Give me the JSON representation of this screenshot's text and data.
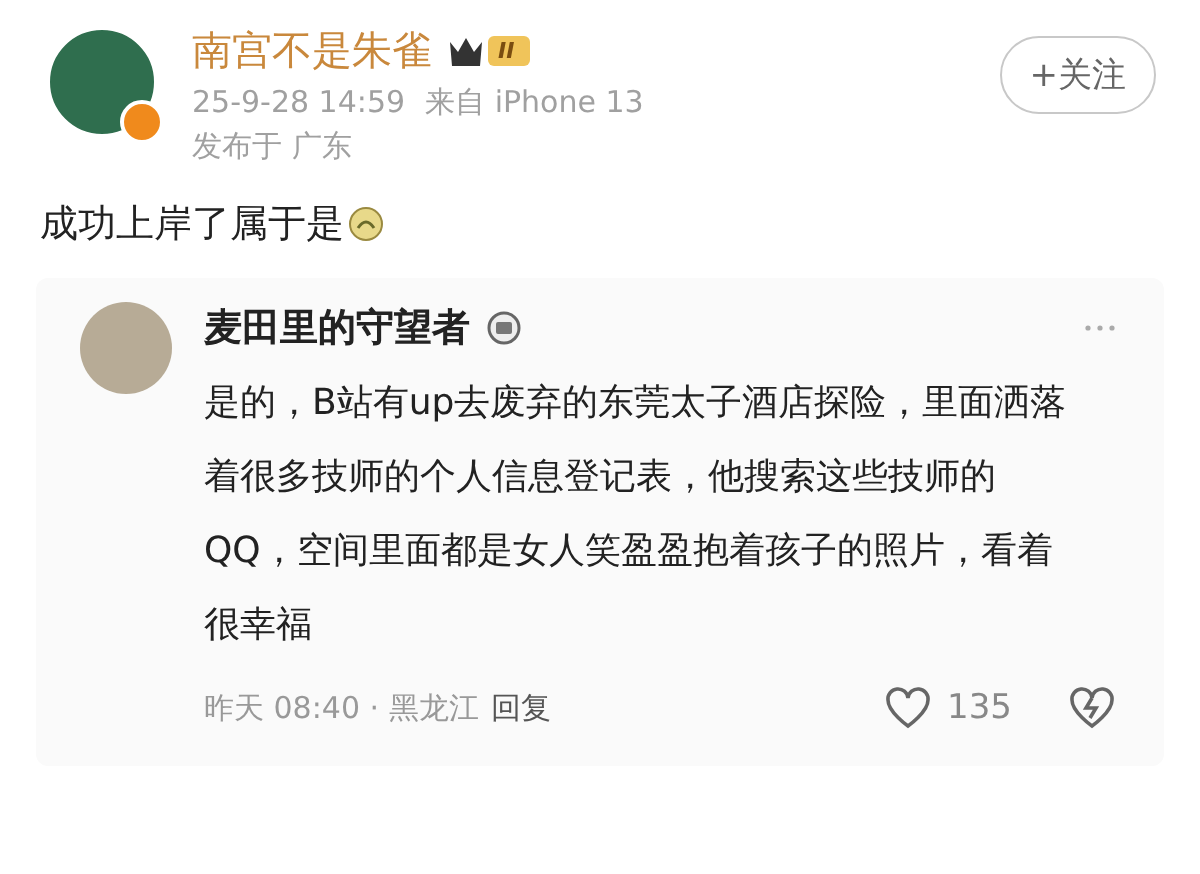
{
  "post": {
    "author": "南宫不是朱雀",
    "level_badge": "II",
    "follow_button": "+关注",
    "time": "25-9-28 14:59",
    "source": "来自 iPhone 13",
    "location": "发布于 广东",
    "text": "成功上岸了属于是"
  },
  "comment": {
    "author": "麦田里的守望者",
    "text": "是的，B站有up去废弃的东莞太子酒店探险，里面洒落着很多技师的个人信息登记表，他搜索这些技师的QQ，空间里面都是女人笑盈盈抱着孩子的照片，看着很幸福",
    "time": "昨天 08:40 · 黑龙江",
    "reply": "回复",
    "likes": "135"
  }
}
